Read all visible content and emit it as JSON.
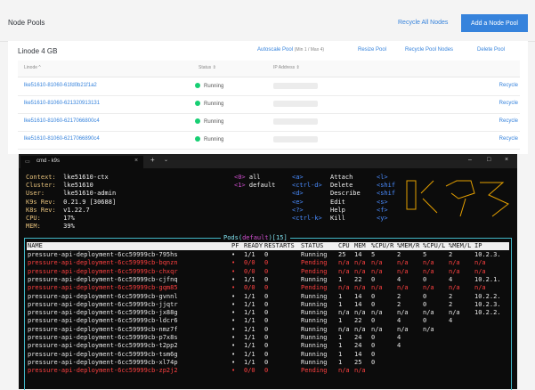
{
  "header": {
    "title": "Node Pools",
    "recycle_all": "Recycle All Nodes",
    "add_node_pool": "Add a Node Pool"
  },
  "pool": {
    "title": "Linode 4 GB",
    "autoscale": "Autoscale Pool",
    "autoscale_sub": "(Min 1 / Max 4)",
    "resize": "Resize Pool",
    "recycle_pool": "Recycle Pool Nodes",
    "delete": "Delete Pool",
    "col_linode": "Linode ^",
    "col_status": "Status",
    "col_ip": "IP Address",
    "rows": [
      {
        "label": "lke51610-81060-61fd0b21f1a2",
        "status": "Running",
        "action": "Recycle"
      },
      {
        "label": "lke51610-81060-621320913131",
        "status": "Running",
        "action": "Recycle"
      },
      {
        "label": "lke51610-81060-6217066800c4",
        "status": "Running",
        "action": "Recycle"
      },
      {
        "label": "lke51610-81060-6217066890c4",
        "status": "Running",
        "action": "Recycle"
      }
    ]
  },
  "terminal": {
    "tab_title": "cmd - k9s",
    "info": [
      {
        "k": "Context:",
        "v": "lke51610-ctx"
      },
      {
        "k": "Cluster:",
        "v": "lke51610"
      },
      {
        "k": "User:",
        "v": "lke51610-admin"
      },
      {
        "k": "K9s Rev:",
        "v": "0.21.9 [30688]"
      },
      {
        "k": "K8s Rev:",
        "v": "v1.22.7"
      },
      {
        "k": "CPU:",
        "v": "17%"
      },
      {
        "k": "MEM:",
        "v": "39%"
      }
    ],
    "namespaces": [
      {
        "k": "<0>",
        "v": "all"
      },
      {
        "k": "<1>",
        "v": "default"
      }
    ],
    "hints1": [
      {
        "k": "<a>",
        "v": "Attach"
      },
      {
        "k": "<ctrl-d>",
        "v": "Delete"
      },
      {
        "k": "<d>",
        "v": "Describe"
      },
      {
        "k": "<e>",
        "v": "Edit"
      },
      {
        "k": "<?>",
        "v": "Help"
      },
      {
        "k": "<ctrl-k>",
        "v": "Kill"
      }
    ],
    "hints2": [
      "<l>",
      "<shif",
      "<shif",
      "<s>",
      "<f>",
      "<y>"
    ],
    "pods_title_prefix": "Pods(",
    "pods_ns": "default",
    "pods_title_suffix": ")[15]",
    "columns": [
      "NAME",
      "PF",
      "READY",
      "RESTARTS",
      "STATUS",
      "CPU",
      "MEM",
      "%CPU/R",
      "%MEM/R",
      "%CPU/L",
      "%MEM/L",
      "IP"
    ],
    "pods": [
      {
        "name": "pressure-api-deployment-6cc59999cb-795hs",
        "pf": "•",
        "ready": "1/1",
        "restarts": "0",
        "status": "Running",
        "cpu": "25",
        "mem": "14",
        "cpur": "5",
        "memr": "2",
        "cpul": "5",
        "meml": "2",
        "ip": "10.2.3.",
        "red": false
      },
      {
        "name": "pressure-api-deployment-6cc59999cb-bqnzn",
        "pf": "•",
        "ready": "0/0",
        "restarts": "0",
        "status": "Pending",
        "cpu": "n/a",
        "mem": "n/a",
        "cpur": "n/a",
        "memr": "n/a",
        "cpul": "n/a",
        "meml": "n/a",
        "ip": "n/a",
        "red": true
      },
      {
        "name": "pressure-api-deployment-6cc59999cb-chxqr",
        "pf": "•",
        "ready": "0/0",
        "restarts": "0",
        "status": "Pending",
        "cpu": "n/a",
        "mem": "n/a",
        "cpur": "n/a",
        "memr": "n/a",
        "cpul": "n/a",
        "meml": "n/a",
        "ip": "n/a",
        "red": true
      },
      {
        "name": "pressure-api-deployment-6cc59999cb-cjfnq",
        "pf": "•",
        "ready": "1/1",
        "restarts": "0",
        "status": "Running",
        "cpu": "1",
        "mem": "22",
        "cpur": "0",
        "memr": "4",
        "cpul": "0",
        "meml": "4",
        "ip": "10.2.1.",
        "red": false
      },
      {
        "name": "pressure-api-deployment-6cc59999cb-gqm85",
        "pf": "•",
        "ready": "0/0",
        "restarts": "0",
        "status": "Pending",
        "cpu": "n/a",
        "mem": "n/a",
        "cpur": "n/a",
        "memr": "n/a",
        "cpul": "n/a",
        "meml": "n/a",
        "ip": "n/a",
        "red": true
      },
      {
        "name": "pressure-api-deployment-6cc59999cb-gvnnl",
        "pf": "•",
        "ready": "1/1",
        "restarts": "0",
        "status": "Running",
        "cpu": "1",
        "mem": "14",
        "cpur": "0",
        "memr": "2",
        "cpul": "0",
        "meml": "2",
        "ip": "10.2.2.",
        "red": false
      },
      {
        "name": "pressure-api-deployment-6cc59999cb-jjqtr",
        "pf": "•",
        "ready": "1/1",
        "restarts": "0",
        "status": "Running",
        "cpu": "1",
        "mem": "14",
        "cpur": "0",
        "memr": "2",
        "cpul": "0",
        "meml": "2",
        "ip": "10.2.3.",
        "red": false
      },
      {
        "name": "pressure-api-deployment-6cc59999cb-jx88g",
        "pf": "•",
        "ready": "1/1",
        "restarts": "0",
        "status": "Running",
        "cpu": "n/a",
        "mem": "n/a",
        "cpur": "n/a",
        "memr": "n/a",
        "cpul": "n/a",
        "meml": "n/a",
        "ip": "10.2.2.",
        "red": false
      },
      {
        "name": "pressure-api-deployment-6cc59999cb-ldcr6",
        "pf": "•",
        "ready": "1/1",
        "restarts": "0",
        "status": "Running",
        "cpu": "1",
        "mem": "22",
        "cpur": "0",
        "memr": "4",
        "cpul": "0",
        "meml": "4",
        "ip": "",
        "red": false
      },
      {
        "name": "pressure-api-deployment-6cc59999cb-nmz7f",
        "pf": "•",
        "ready": "1/1",
        "restarts": "0",
        "status": "Running",
        "cpu": "n/a",
        "mem": "n/a",
        "cpur": "n/a",
        "memr": "n/a",
        "cpul": "n/a",
        "meml": "",
        "ip": "",
        "red": false
      },
      {
        "name": "pressure-api-deployment-6cc59999cb-p7x8s",
        "pf": "•",
        "ready": "1/1",
        "restarts": "0",
        "status": "Running",
        "cpu": "1",
        "mem": "24",
        "cpur": "0",
        "memr": "4",
        "cpul": "",
        "meml": "",
        "ip": "",
        "red": false
      },
      {
        "name": "pressure-api-deployment-6cc59999cb-t2pp2",
        "pf": "•",
        "ready": "1/1",
        "restarts": "0",
        "status": "Running",
        "cpu": "1",
        "mem": "24",
        "cpur": "0",
        "memr": "4",
        "cpul": "",
        "meml": "",
        "ip": "",
        "red": false
      },
      {
        "name": "pressure-api-deployment-6cc59999cb-tsm6g",
        "pf": "•",
        "ready": "1/1",
        "restarts": "0",
        "status": "Running",
        "cpu": "1",
        "mem": "14",
        "cpur": "0",
        "memr": "",
        "cpul": "",
        "meml": "",
        "ip": "",
        "red": false
      },
      {
        "name": "pressure-api-deployment-6cc59999cb-xl74p",
        "pf": "•",
        "ready": "1/1",
        "restarts": "0",
        "status": "Running",
        "cpu": "1",
        "mem": "25",
        "cpur": "0",
        "memr": "",
        "cpul": "",
        "meml": "",
        "ip": "",
        "red": false
      },
      {
        "name": "pressure-api-deployment-6cc59999cb-zp2j2",
        "pf": "•",
        "ready": "0/0",
        "restarts": "0",
        "status": "Pending",
        "cpu": "n/a",
        "mem": "n/a",
        "cpur": "",
        "memr": "",
        "cpul": "",
        "meml": "",
        "ip": "",
        "red": true
      }
    ]
  },
  "colors": {
    "accent": "#3683dc",
    "running": "#17cf73",
    "pending": "#ff4040",
    "frame": "#42b8c8"
  }
}
